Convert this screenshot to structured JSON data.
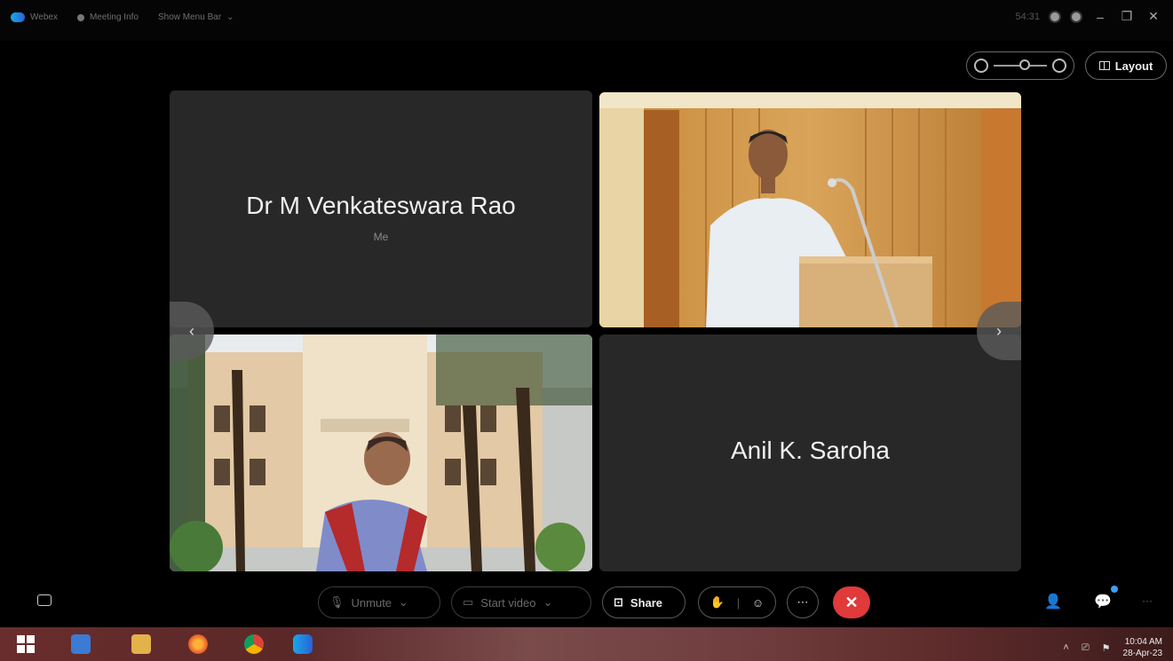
{
  "titlebar": {
    "app_name": "Webex",
    "meeting_info": "Meeting Info",
    "show_menu_bar": "Show Menu Bar",
    "timer": "54:31"
  },
  "view": {
    "layout_label": "Layout"
  },
  "participants": [
    {
      "name": "Dr M Venkateswara Rao",
      "sublabel": "Me",
      "video": false
    },
    {
      "name": "",
      "video": true
    },
    {
      "name": "",
      "video": true
    },
    {
      "name": "Anil K. Saroha",
      "video": false
    }
  ],
  "controls": {
    "unmute": "Unmute",
    "start_video": "Start video",
    "share": "Share"
  },
  "taskbar": {
    "time": "10:04 AM",
    "date": "28-Apr-23"
  },
  "colors": {
    "end_call": "#e03a3a",
    "tile_bg": "#282828",
    "accent": "#3aa0ff"
  }
}
